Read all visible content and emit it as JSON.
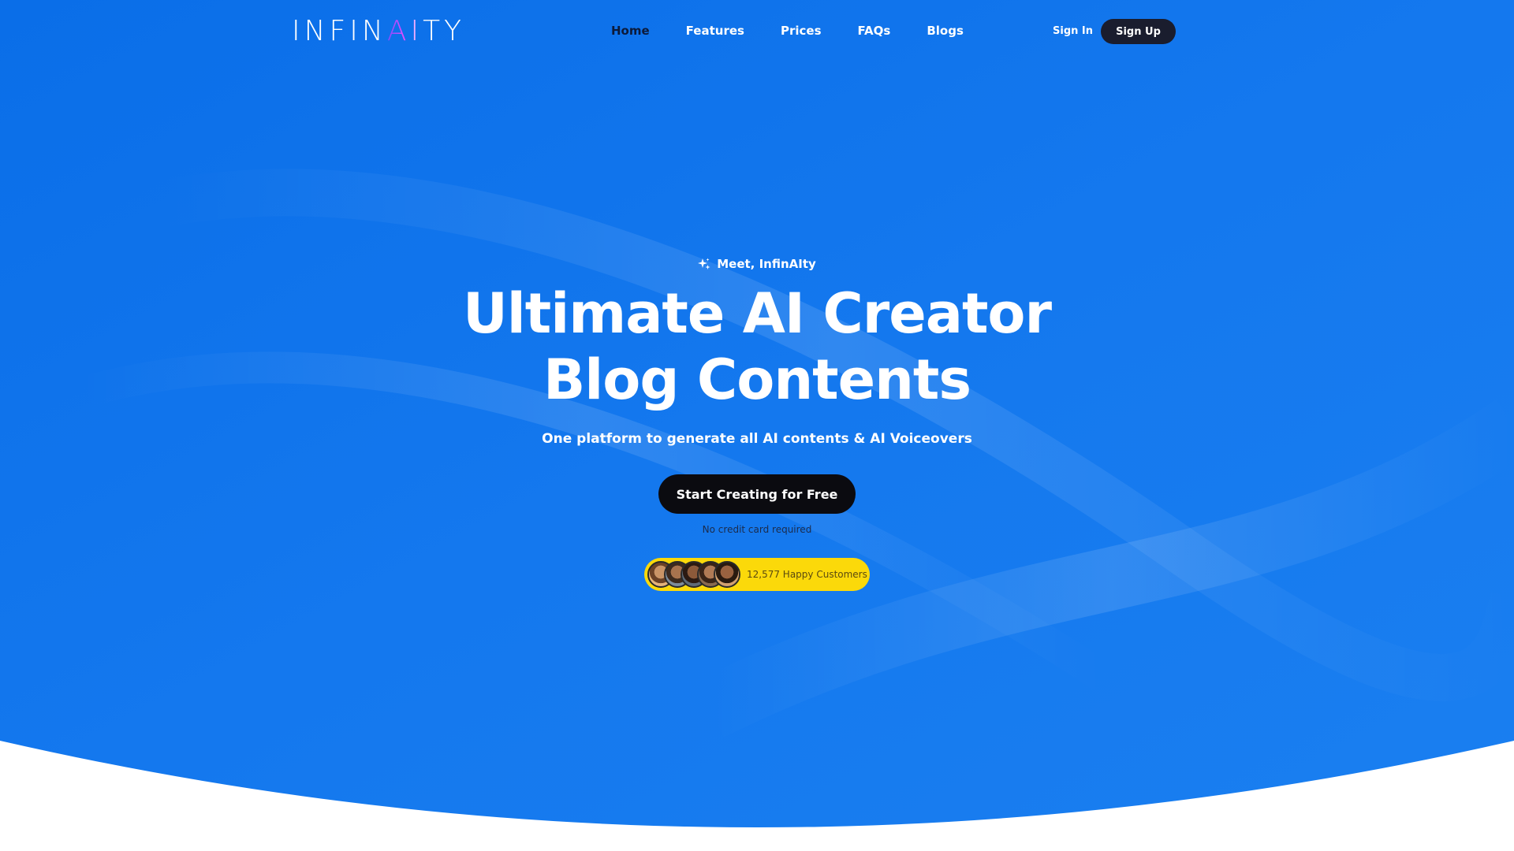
{
  "nav": {
    "logo_left": "INFIN",
    "logo_ai": "AI",
    "logo_right": "TY",
    "links": [
      {
        "label": "Home",
        "active": true
      },
      {
        "label": "Features",
        "active": false
      },
      {
        "label": "Prices",
        "active": false
      },
      {
        "label": "FAQs",
        "active": false
      },
      {
        "label": "Blogs",
        "active": false
      }
    ],
    "signin_label": "Sign In",
    "signup_label": "Sign Up"
  },
  "hero": {
    "eyebrow_icon": "sparkle-icon",
    "eyebrow": "Meet, InfinAIty",
    "headline_line1": "Ultimate AI Creator",
    "headline_line2": "Blog Contents",
    "subtitle": "One platform to generate all AI contents & AI Voiceovers",
    "cta_label": "Start Creating for Free",
    "note": "No credit card required",
    "customers_text": "12,577 Happy Customers"
  },
  "colors": {
    "hero_bg": "#1070e8",
    "cta_bg": "#0b0b10",
    "badge_bg": "#fbd90a",
    "signup_bg": "#1a1d2e",
    "nav_active": "#0c1a3a"
  }
}
